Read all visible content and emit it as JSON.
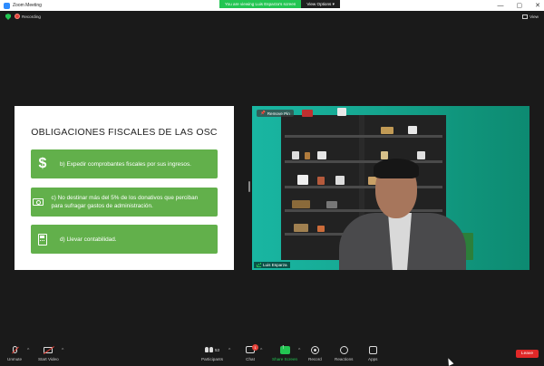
{
  "window": {
    "title": "Zoom Meeting",
    "controls": [
      "—",
      "▢",
      "✕"
    ]
  },
  "banner": {
    "viewing_text": "You are viewing Luis Esparza's screen",
    "view_options": "View Options ▾"
  },
  "header": {
    "recording_label": "Recording",
    "view_label": "View"
  },
  "slide": {
    "title": "OBLIGACIONES FISCALES DE LAS OSC",
    "bullets": [
      {
        "icon": "dollar-icon",
        "text": "b) Expedir comprobantes fiscales por sus ingresos."
      },
      {
        "icon": "money-icon",
        "text": "c) No destinar más del 5% de los donativos que perciban para sufragar gastos de administración."
      },
      {
        "icon": "calculator-icon",
        "text": "d) Llevar contabilidad."
      }
    ],
    "accent": "#62b04b"
  },
  "video": {
    "remove_pin": "Remove Pin",
    "participant_name": "Luis Esparza"
  },
  "toolbar": {
    "unmute": "Unmute",
    "start_video": "Start Video",
    "participants": "Participants",
    "participants_count": "53",
    "chat": "Chat",
    "chat_badge": "1",
    "share_screen": "Share Screen",
    "record": "Record",
    "reactions": "Reactions",
    "apps": "Apps",
    "leave": "Leave"
  },
  "colors": {
    "green": "#23c552",
    "red": "#e02828",
    "background": "#1a1a1a"
  }
}
